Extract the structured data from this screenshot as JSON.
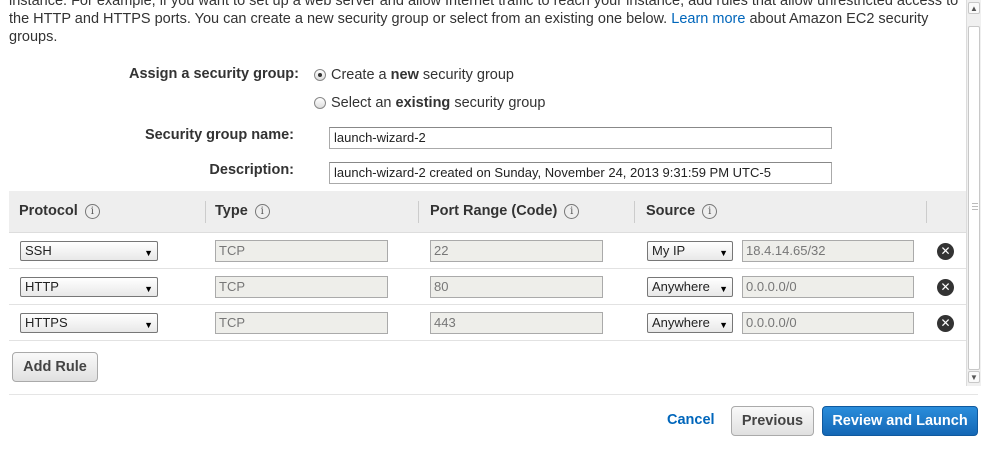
{
  "intro": {
    "line1": "instance. For example, if you want to set up a web server and allow Internet traffic to reach your instance, add rules that allow unrestricted access to",
    "line2_pre": "the HTTP and HTTPS ports. You can create a new security group or select from an existing one below.",
    "learn_more": "Learn more",
    "line2_post": "about Amazon EC2 security",
    "line3": "groups."
  },
  "assign": {
    "label": "Assign a security group:",
    "option_new_pre": "Create a",
    "option_new_bold": "new",
    "option_new_post": "security group",
    "option_existing_pre": "Select an",
    "option_existing_bold": "existing",
    "option_existing_post": "security group",
    "selected": "new"
  },
  "group_name": {
    "label": "Security group name:",
    "value": "launch-wizard-2"
  },
  "description": {
    "label": "Description:",
    "value": "launch-wizard-2 created on Sunday, November 24, 2013 9:31:59 PM UTC-5"
  },
  "table": {
    "headers": {
      "protocol": "Protocol",
      "type": "Type",
      "port_range": "Port Range (Code)",
      "source": "Source"
    },
    "info_glyph": "i",
    "rows": [
      {
        "protocol": "SSH",
        "type": "TCP",
        "port": "22",
        "source": "My IP",
        "cidr": "18.4.14.65/32"
      },
      {
        "protocol": "HTTP",
        "type": "TCP",
        "port": "80",
        "source": "Anywhere",
        "cidr": "0.0.0.0/0"
      },
      {
        "protocol": "HTTPS",
        "type": "TCP",
        "port": "443",
        "source": "Anywhere",
        "cidr": "0.0.0.0/0"
      }
    ],
    "remove_glyph": "✕"
  },
  "add_rule": "Add Rule",
  "footer": {
    "cancel": "Cancel",
    "previous": "Previous",
    "review_launch": "Review and Launch"
  },
  "colors": {
    "link": "#0066bb",
    "primary": "#1a74c4",
    "header_bg": "#eeeeee"
  }
}
